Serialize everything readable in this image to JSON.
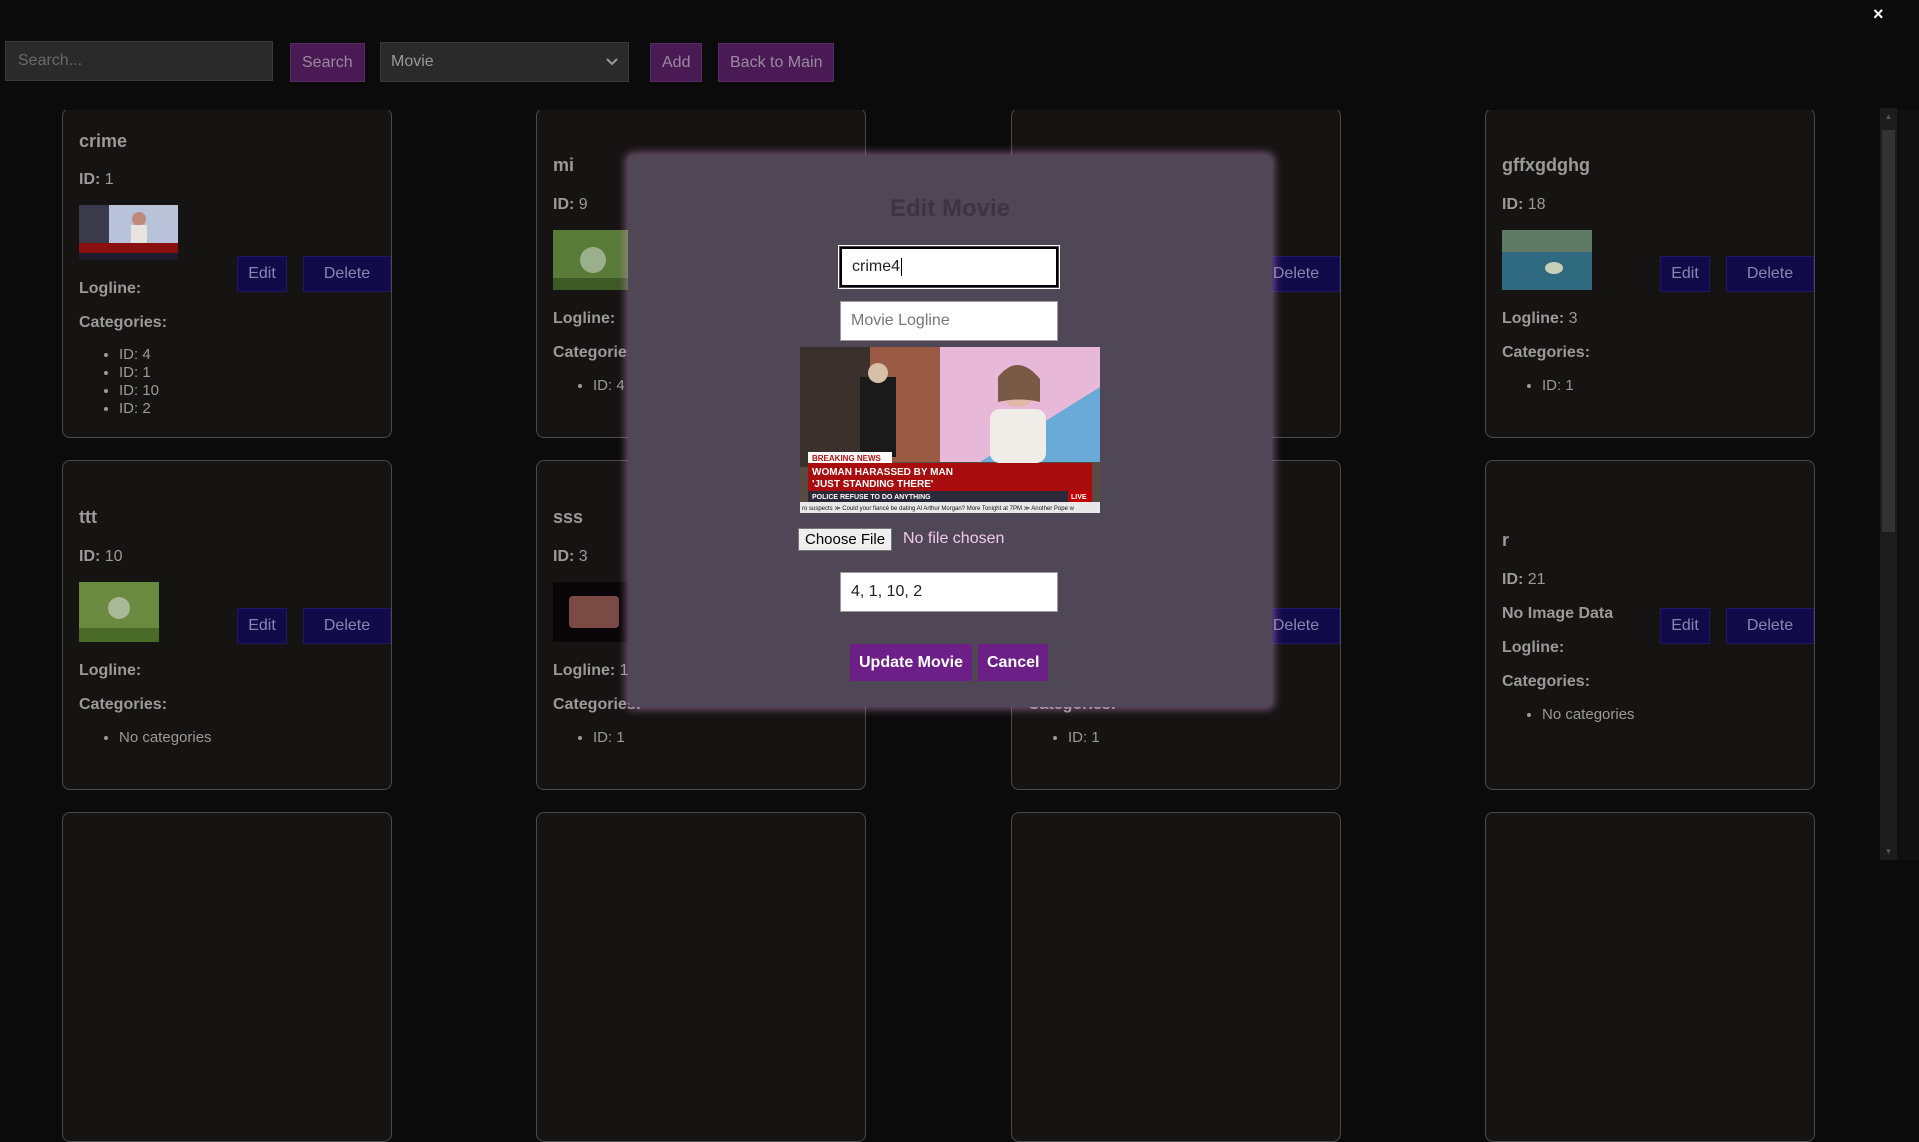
{
  "toolbar": {
    "search_placeholder": "Search...",
    "search_label": "Search",
    "type_selected": "Movie",
    "add_label": "Add",
    "back_label": "Back to Main"
  },
  "close_label": "×",
  "labels": {
    "id": "ID:",
    "logline": "Logline:",
    "categories": "Categories:",
    "edit": "Edit",
    "delete": "Delete"
  },
  "cards": [
    {
      "title": "crime",
      "id": "1",
      "logline": "",
      "categories": [
        "ID: 4",
        "ID: 1",
        "ID: 10",
        "ID: 2"
      ]
    },
    {
      "title": "mi",
      "id": "9",
      "logline": "",
      "categories": [
        "ID: 4"
      ]
    },
    {
      "title": "",
      "id": "",
      "logline": "",
      "categories": []
    },
    {
      "title": "gffxgdghg",
      "id": "18",
      "logline": "3",
      "categories": [
        "ID: 1"
      ]
    },
    {
      "title": "ttt",
      "id": "10",
      "logline": "",
      "categories": [
        "No categories"
      ]
    },
    {
      "title": "sss",
      "id": "3",
      "logline": "1",
      "categories": [
        "ID: 1"
      ]
    },
    {
      "title": "",
      "id": "",
      "logline": "",
      "categories": [
        "ID: 1"
      ]
    },
    {
      "title": "r",
      "id": "21",
      "no_image": "No Image Data",
      "logline": "",
      "categories": [
        "No categories"
      ]
    }
  ],
  "modal": {
    "title": "Edit Movie",
    "name_value": "crime4",
    "logline_placeholder": "Movie Logline",
    "file_button": "Choose File",
    "file_status": "No file chosen",
    "categories_value": "4, 1, 10, 2",
    "update_label": "Update Movie",
    "cancel_label": "Cancel",
    "preview": {
      "badge": "BREAKING NEWS",
      "headline_1": "WOMAN HARASSED BY MAN",
      "headline_2": "'JUST STANDING THERE'",
      "subline": "POLICE REFUSE TO DO ANYTHING",
      "live": "LIVE",
      "ticker": "ro suspects  ≫  Could your fiancé be dating Al Arthur Morgan? More Tonight at 7PM  ≫  Another Pope w"
    }
  }
}
